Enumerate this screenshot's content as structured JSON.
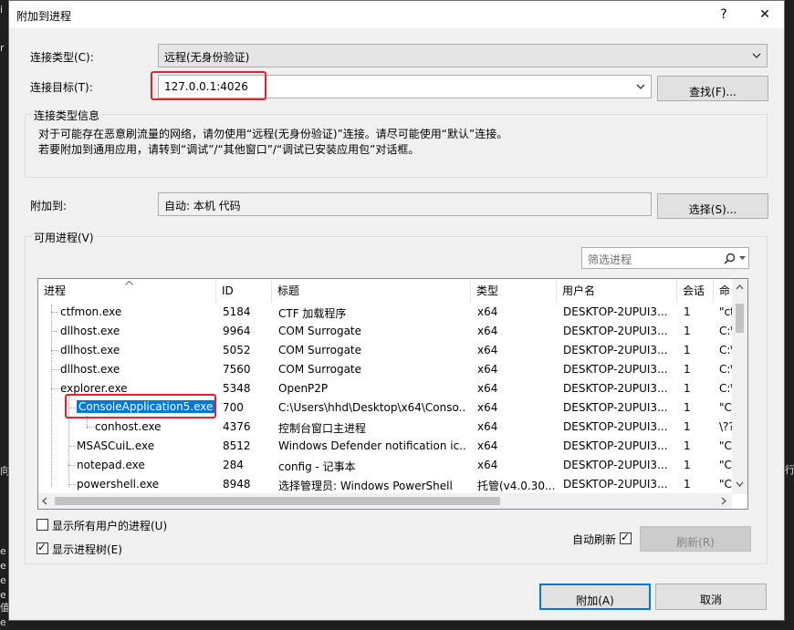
{
  "window": {
    "title": "附加到进程",
    "help_label": "?",
    "close_label": "✕"
  },
  "connection": {
    "type_label": "连接类型(C):",
    "type_value": "远程(无身份验证)",
    "target_label": "连接目标(T):",
    "target_value": "127.0.0.1:4026",
    "find_button": "查找(F)..."
  },
  "info": {
    "title": "连接类型信息",
    "line1": "对于可能存在恶意刷流量的网络，请勿使用“远程(无身份验证)”连接。请尽可能使用“默认”连接。",
    "line2": "若要附加到通用应用，请转到“调试”/“其他窗口”/“调试已安装应用包”对话框。"
  },
  "attach_to": {
    "label": "附加到:",
    "value": "自动: 本机 代码",
    "select_button": "选择(S)..."
  },
  "processes": {
    "group_label": "可用进程(V)",
    "filter_placeholder": "筛选进程",
    "columns": [
      "进程",
      "ID",
      "标题",
      "类型",
      "用户名",
      "会话",
      "命"
    ],
    "rows": [
      {
        "name": "ctfmon.exe",
        "id": "5184",
        "title": "CTF 加载程序",
        "type": "x64",
        "user": "DESKTOP-2UPUI3...",
        "session": "1",
        "cmd": "\"ct"
      },
      {
        "name": "dllhost.exe",
        "id": "9964",
        "title": "COM Surrogate",
        "type": "x64",
        "user": "DESKTOP-2UPUI3...",
        "session": "1",
        "cmd": "C:\\"
      },
      {
        "name": "dllhost.exe",
        "id": "5052",
        "title": "COM Surrogate",
        "type": "x64",
        "user": "DESKTOP-2UPUI3...",
        "session": "1",
        "cmd": "C:\\"
      },
      {
        "name": "dllhost.exe",
        "id": "7560",
        "title": "COM Surrogate",
        "type": "x64",
        "user": "DESKTOP-2UPUI3...",
        "session": "1",
        "cmd": "C:\\"
      },
      {
        "name": "explorer.exe",
        "id": "5348",
        "title": "OpenP2P",
        "type": "x64",
        "user": "DESKTOP-2UPUI3...",
        "session": "1",
        "cmd": "C:\\"
      },
      {
        "name": "ConsoleApplication5.exe",
        "id": "700",
        "title": "C:\\Users\\hhd\\Desktop\\x64\\Conso...",
        "type": "x64",
        "user": "DESKTOP-2UPUI3...",
        "session": "1",
        "cmd": "\"C:"
      },
      {
        "name": "conhost.exe",
        "id": "4376",
        "title": "控制台窗口主进程",
        "type": "x64",
        "user": "DESKTOP-2UPUI3...",
        "session": "1",
        "cmd": "\\??"
      },
      {
        "name": "MSASCuiL.exe",
        "id": "8512",
        "title": "Windows Defender notification ic...",
        "type": "x64",
        "user": "DESKTOP-2UPUI3...",
        "session": "1",
        "cmd": "\"C:"
      },
      {
        "name": "notepad.exe",
        "id": "284",
        "title": "config - 记事本",
        "type": "x64",
        "user": "DESKTOP-2UPUI3...",
        "session": "1",
        "cmd": "\"C:"
      },
      {
        "name": "powershell.exe",
        "id": "8948",
        "title": "选择管理员: Windows PowerShell",
        "type": "托管(v4.0.30...",
        "user": "DESKTOP-2UPUI3...",
        "session": "1",
        "cmd": "\"C:"
      }
    ],
    "show_all_users": "显示所有用户的进程(U)",
    "show_tree": "显示进程树(E)",
    "auto_refresh": "自动刷新",
    "refresh_button": "刷新(R)"
  },
  "footer": {
    "attach_button": "附加(A)",
    "cancel_button": "取消"
  },
  "background": {
    "left_chars": [
      "i",
      "r",
      "向",
      "e",
      "e",
      "e",
      "e",
      "值",
      "e"
    ],
    "right_char": "行"
  },
  "colors": {
    "accent": "#0078d7",
    "highlight_red": "#e8202a"
  }
}
